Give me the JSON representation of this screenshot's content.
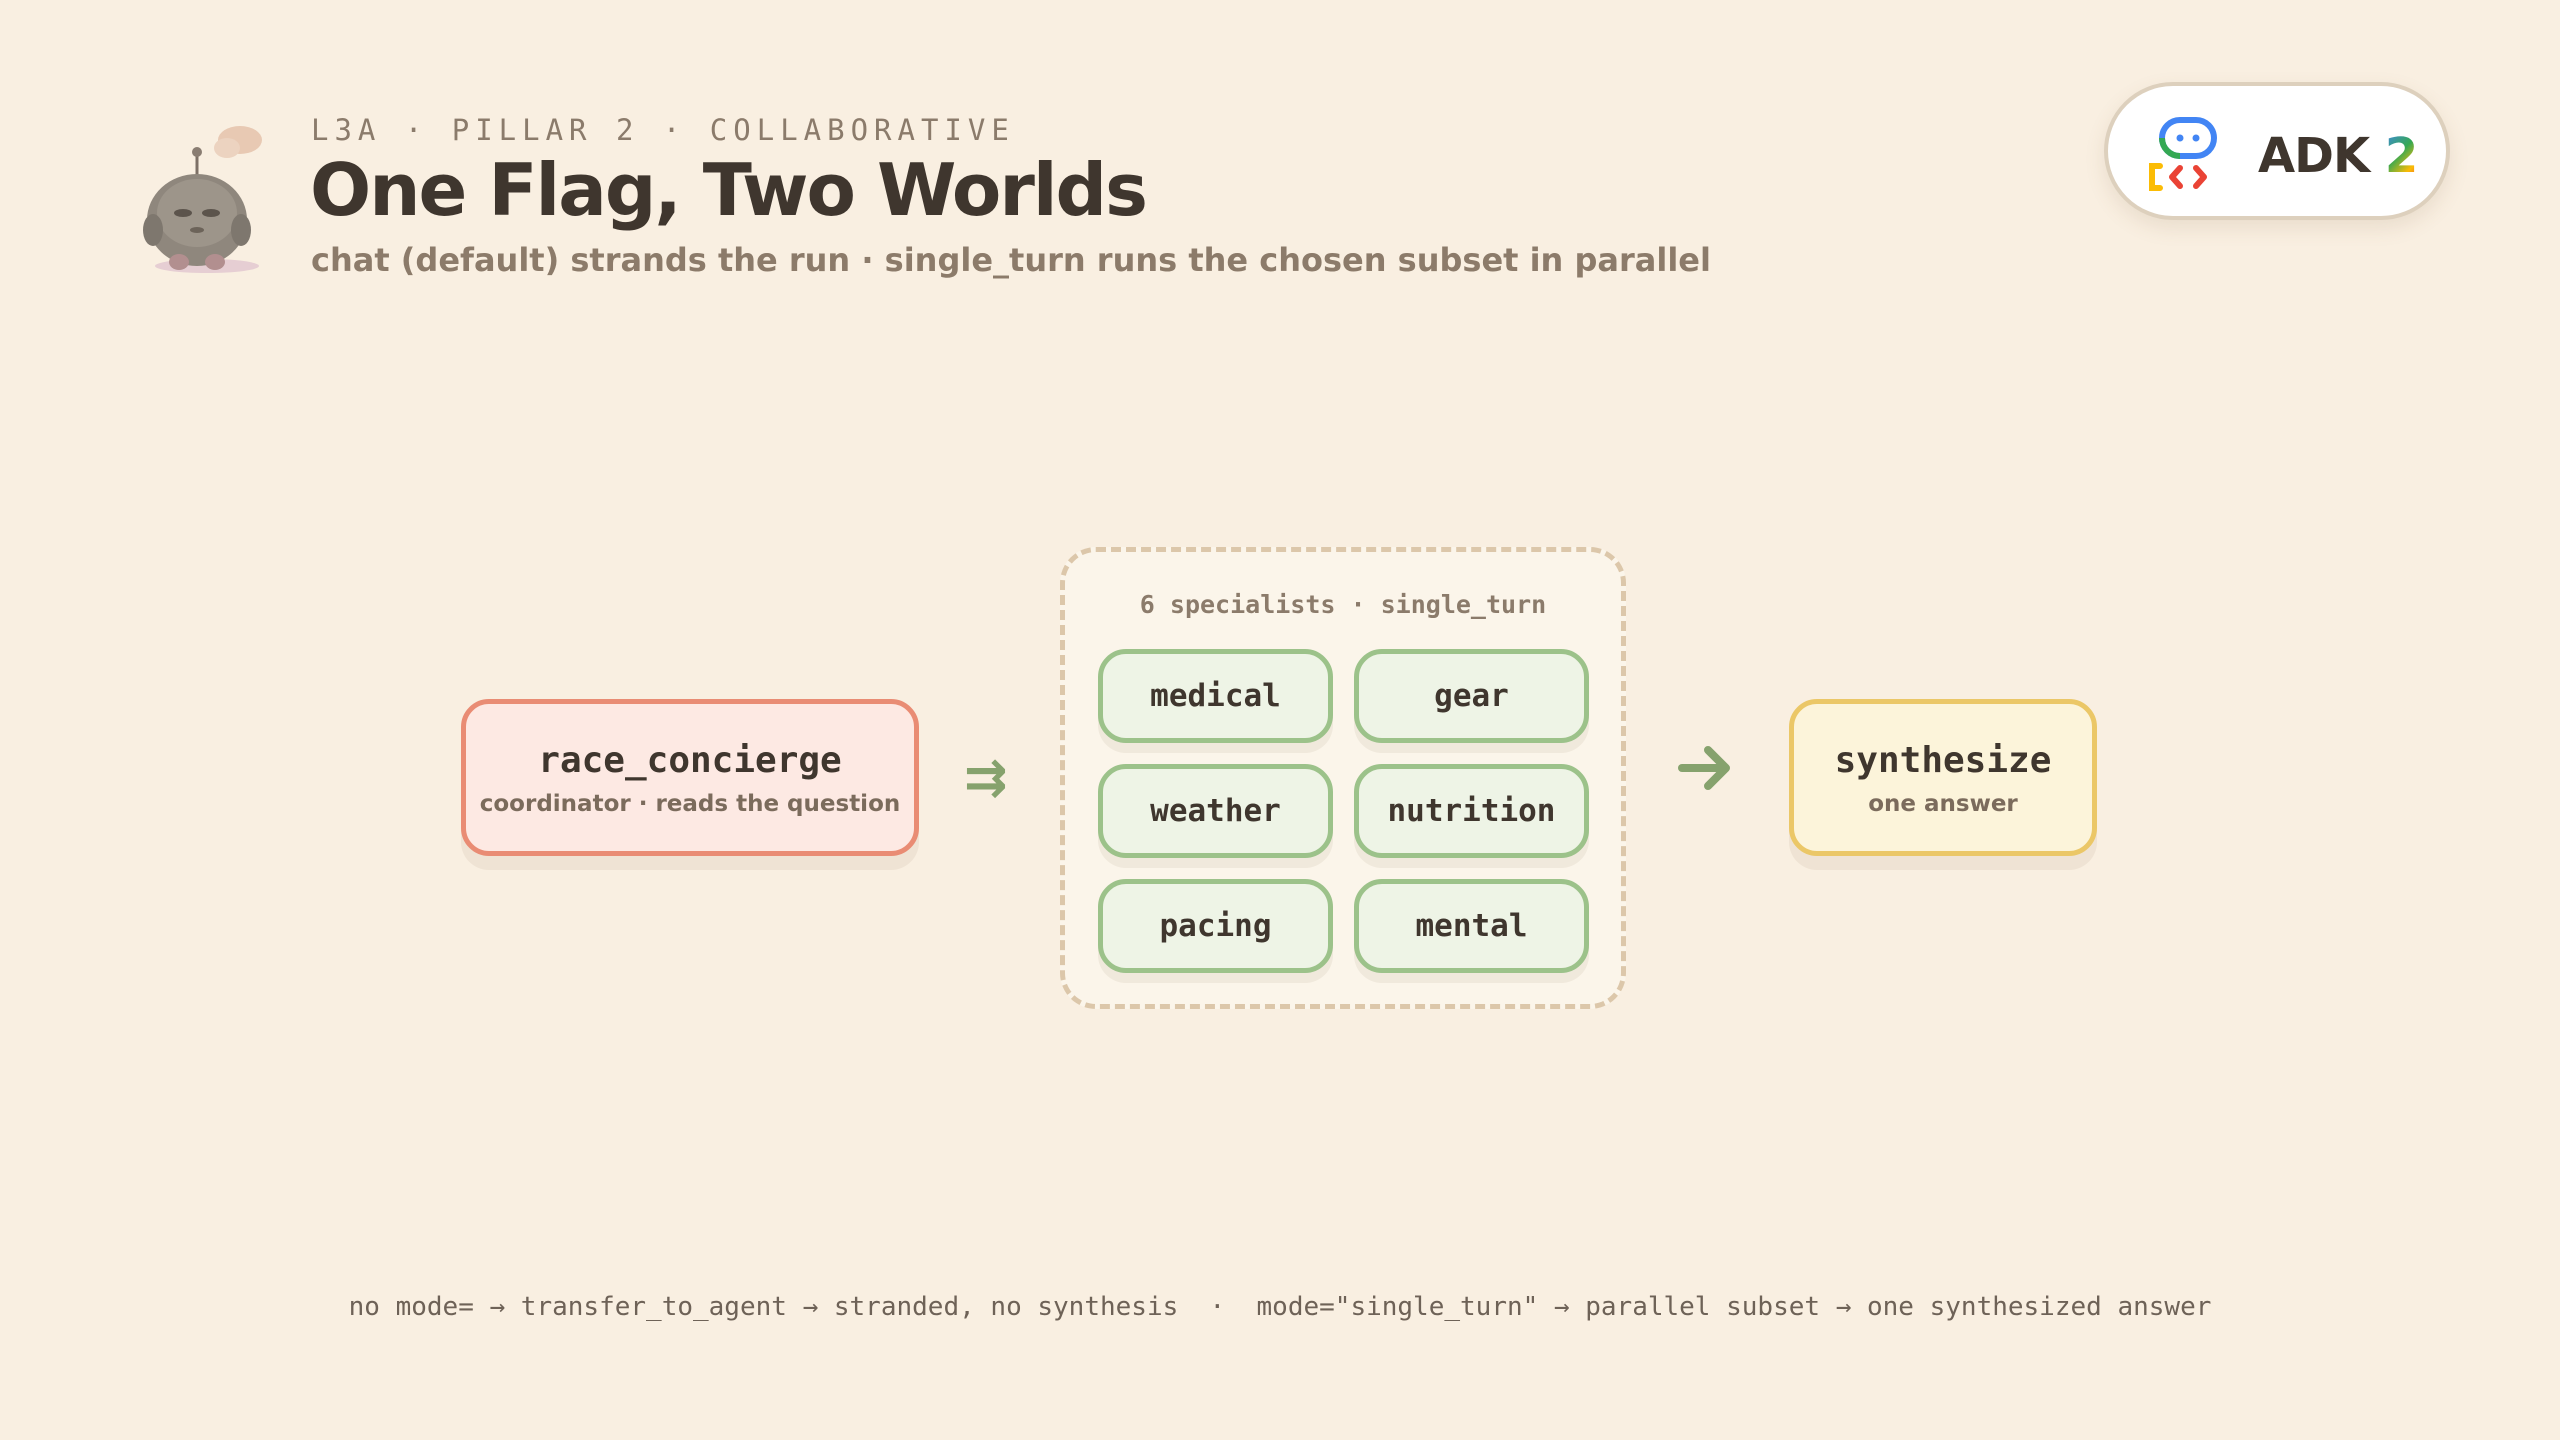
{
  "header": {
    "kicker": "L3A · PILLAR 2 · COLLABORATIVE",
    "title": "One Flag, Two Worlds",
    "subtitle": "chat (default) strands the run · single_turn runs the chosen subset in parallel",
    "mascot_icon": "robot-mascot-icon"
  },
  "badge": {
    "text": "ADK",
    "version": "2",
    "icon": "adk-logo-icon",
    "colors": [
      "#4285f4",
      "#34a853",
      "#fbbc05",
      "#ea4335"
    ]
  },
  "diagram": {
    "coordinator": {
      "name": "race_concierge",
      "description": "coordinator · reads the question",
      "color": "#e98c74"
    },
    "specialists": {
      "label": "6 specialists · single_turn",
      "items": [
        "medical",
        "gear",
        "weather",
        "nutrition",
        "pacing",
        "mental"
      ],
      "color": "#9cc28a"
    },
    "synthesizer": {
      "name": "synthesize",
      "description": "one answer",
      "color": "#ebc767"
    },
    "fan_out_arrow": "⇉",
    "merge_arrow_icon": "arrow-right-icon"
  },
  "footnote": "no mode= → transfer_to_agent → stranded, no synthesis  ·  mode=\"single_turn\" → parallel subset → one synthesized answer"
}
